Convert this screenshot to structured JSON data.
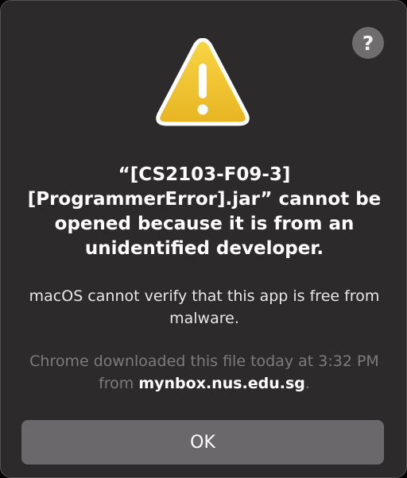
{
  "dialog": {
    "help_label": "?",
    "icon": "warning-triangle-icon",
    "title": "“[CS2103-F09-3] [ProgrammerError].jar” cannot be opened because it is from an unidentified developer.",
    "message": "macOS cannot verify that this app is free from malware.",
    "source_prefix": "Chrome downloaded this file today at 3:32 PM from ",
    "source_host": "mynbox.nus.edu.sg",
    "source_suffix": ".",
    "ok_label": "OK"
  },
  "colors": {
    "background": "#2c2a2b",
    "button": "#6a686a",
    "warning_yellow": "#f3c52c",
    "secondary_text": "#7d7b7c"
  }
}
